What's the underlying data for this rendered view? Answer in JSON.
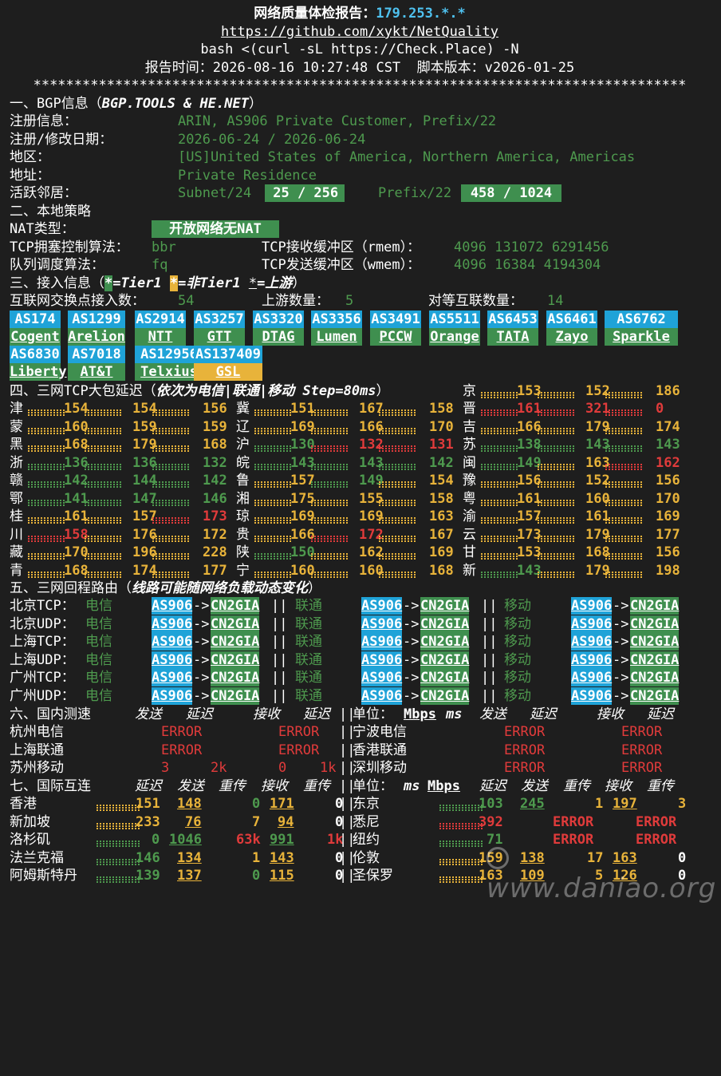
{
  "header": {
    "title_label": "网络质量体检报告：",
    "title_ip": "179.253.*.*",
    "url": "https://github.com/xykt/NetQuality",
    "command": "bash <(curl -sL https://Check.Place) -N",
    "time_line": "报告时间：2026-08-16 10:27:48 CST  脚本版本：v2026-01-25",
    "separator": "********************************************************************************"
  },
  "bgp": {
    "heading": "一、BGP信息（",
    "heading_source": "BGP.TOOLS & HE.NET",
    "heading_close": "）",
    "rows": [
      {
        "label": "注册信息：",
        "value": "ARIN, AS906 Private Customer, Prefix/22"
      },
      {
        "label": "注册/修改日期：",
        "value": "2026-06-24 / 2026-06-24"
      },
      {
        "label": "地区：",
        "value": "[US]United States of America, Northern America, Americas"
      },
      {
        "label": "地址：",
        "value": "Private Residence"
      }
    ],
    "neighbors_label": "活跃邻居：",
    "subnet_label": "Subnet/24",
    "subnet_value": " 25 / 256 ",
    "prefix_label": "Prefix/22",
    "prefix_value": " 458 / 1024 "
  },
  "local": {
    "heading": "二、本地策略",
    "nat_label": "NAT类型：",
    "nat_value": " 开放网络无NAT ",
    "tcp_cc_label": "TCP拥塞控制算法：",
    "tcp_cc_value": "bbr",
    "rmem_label": "TCP接收缓冲区（rmem）：",
    "rmem_value": "4096 131072 6291456",
    "qdisc_label": "队列调度算法：",
    "qdisc_value": "fq",
    "wmem_label": "TCP发送缓冲区（wmem）：",
    "wmem_value": "4096 16384 4194304"
  },
  "access": {
    "heading": "三、接入信息（",
    "legend1_mark": "*",
    "legend1_text": "=Tier1 ",
    "legend2_mark": "*",
    "legend2_text": "=非Tier1 ",
    "legend3_mark": "*",
    "legend3_text": "=上游",
    "heading_close": "）",
    "ix_label": "互联网交换点接入数：",
    "ix_value": "54",
    "upstream_label": "上游数量：",
    "upstream_value": "5",
    "peer_label": "对等互联数量：",
    "peer_value": "14",
    "as_list": [
      {
        "asn": "AS174",
        "name": "Cogent",
        "tier": "t1"
      },
      {
        "asn": "AS1299",
        "name": "Arelion",
        "tier": "t1"
      },
      {
        "asn": "AS2914",
        "name": "NTT",
        "tier": "t1"
      },
      {
        "asn": "AS3257",
        "name": "GTT",
        "tier": "t1"
      },
      {
        "asn": "AS3320",
        "name": "DTAG",
        "tier": "t1"
      },
      {
        "asn": "AS3356",
        "name": "Lumen",
        "tier": "t1"
      },
      {
        "asn": "AS3491",
        "name": "PCCW",
        "tier": "t1"
      },
      {
        "asn": "AS5511",
        "name": "Orange",
        "tier": "t1"
      },
      {
        "asn": "AS6453",
        "name": "TATA",
        "tier": "t1"
      },
      {
        "asn": "AS6461",
        "name": "Zayo",
        "tier": "t1"
      },
      {
        "asn": "AS6762",
        "name": "Sparkle",
        "tier": "t1"
      },
      {
        "asn": "AS6830",
        "name": "Liberty",
        "tier": "t1"
      },
      {
        "asn": "AS7018",
        "name": "AT&T",
        "tier": "t1"
      },
      {
        "asn": "AS12956",
        "name": "Telxius",
        "tier": "t1"
      },
      {
        "asn": "AS137409",
        "name": "GSL",
        "tier": "nt1"
      }
    ]
  },
  "latency": {
    "heading": "四、三网TCP大包延迟（",
    "heading_note": "依次为电信|联通|移动 Step=80ms",
    "heading_close": "）",
    "first": {
      "name": "京",
      "v": [
        "153",
        "152",
        "186"
      ],
      "c": [
        "y",
        "y",
        "y"
      ]
    },
    "rows": [
      [
        {
          "name": "津",
          "v": [
            "154",
            "154",
            "156"
          ],
          "c": [
            "y",
            "y",
            "y"
          ]
        },
        {
          "name": "冀",
          "v": [
            "151",
            "167",
            "158"
          ],
          "c": [
            "y",
            "y",
            "y"
          ]
        },
        {
          "name": "晋",
          "v": [
            "161",
            "321",
            "0"
          ],
          "c": [
            "r",
            "r",
            "r"
          ]
        }
      ],
      [
        {
          "name": "蒙",
          "v": [
            "160",
            "159",
            "159"
          ],
          "c": [
            "y",
            "y",
            "y"
          ]
        },
        {
          "name": "辽",
          "v": [
            "169",
            "166",
            "170"
          ],
          "c": [
            "y",
            "y",
            "y"
          ]
        },
        {
          "name": "吉",
          "v": [
            "166",
            "179",
            "174"
          ],
          "c": [
            "y",
            "y",
            "y"
          ]
        }
      ],
      [
        {
          "name": "黑",
          "v": [
            "168",
            "179",
            "168"
          ],
          "c": [
            "y",
            "y",
            "y"
          ]
        },
        {
          "name": "沪",
          "v": [
            "130",
            "132",
            "131"
          ],
          "c": [
            "gn",
            "r",
            "r"
          ]
        },
        {
          "name": "苏",
          "v": [
            "138",
            "143",
            "143"
          ],
          "c": [
            "gn",
            "gn",
            "gn"
          ]
        }
      ],
      [
        {
          "name": "浙",
          "v": [
            "136",
            "136",
            "132"
          ],
          "c": [
            "gn",
            "gn",
            "gn"
          ]
        },
        {
          "name": "皖",
          "v": [
            "143",
            "143",
            "142"
          ],
          "c": [
            "gn",
            "gn",
            "gn"
          ]
        },
        {
          "name": "闽",
          "v": [
            "149",
            "163",
            "162"
          ],
          "c": [
            "gn",
            "y",
            "r"
          ]
        }
      ],
      [
        {
          "name": "赣",
          "v": [
            "142",
            "144",
            "142"
          ],
          "c": [
            "gn",
            "gn",
            "gn"
          ]
        },
        {
          "name": "鲁",
          "v": [
            "157",
            "149",
            "154"
          ],
          "c": [
            "y",
            "gn",
            "y"
          ]
        },
        {
          "name": "豫",
          "v": [
            "156",
            "152",
            "156"
          ],
          "c": [
            "y",
            "y",
            "y"
          ]
        }
      ],
      [
        {
          "name": "鄂",
          "v": [
            "141",
            "147",
            "146"
          ],
          "c": [
            "gn",
            "gn",
            "gn"
          ]
        },
        {
          "name": "湘",
          "v": [
            "175",
            "155",
            "158"
          ],
          "c": [
            "y",
            "y",
            "y"
          ]
        },
        {
          "name": "粤",
          "v": [
            "161",
            "160",
            "170"
          ],
          "c": [
            "y",
            "y",
            "y"
          ]
        }
      ],
      [
        {
          "name": "桂",
          "v": [
            "161",
            "157",
            "173"
          ],
          "c": [
            "y",
            "y",
            "r"
          ]
        },
        {
          "name": "琼",
          "v": [
            "169",
            "169",
            "163"
          ],
          "c": [
            "y",
            "y",
            "y"
          ]
        },
        {
          "name": "渝",
          "v": [
            "157",
            "161",
            "169"
          ],
          "c": [
            "y",
            "y",
            "y"
          ]
        }
      ],
      [
        {
          "name": "川",
          "v": [
            "158",
            "176",
            "172"
          ],
          "c": [
            "r",
            "y",
            "y"
          ]
        },
        {
          "name": "贵",
          "v": [
            "166",
            "172",
            "167"
          ],
          "c": [
            "y",
            "r",
            "y"
          ]
        },
        {
          "name": "云",
          "v": [
            "173",
            "179",
            "177"
          ],
          "c": [
            "y",
            "y",
            "y"
          ]
        }
      ],
      [
        {
          "name": "藏",
          "v": [
            "170",
            "196",
            "228"
          ],
          "c": [
            "y",
            "y",
            "y"
          ]
        },
        {
          "name": "陕",
          "v": [
            "150",
            "162",
            "169"
          ],
          "c": [
            "gn",
            "y",
            "y"
          ]
        },
        {
          "name": "甘",
          "v": [
            "153",
            "168",
            "156"
          ],
          "c": [
            "y",
            "y",
            "y"
          ]
        }
      ],
      [
        {
          "name": "青",
          "v": [
            "168",
            "174",
            "177"
          ],
          "c": [
            "y",
            "y",
            "y"
          ]
        },
        {
          "name": "宁",
          "v": [
            "160",
            "160",
            "168"
          ],
          "c": [
            "y",
            "y",
            "y"
          ]
        },
        {
          "name": "新",
          "v": [
            "143",
            "179",
            "198"
          ],
          "c": [
            "gn",
            "y",
            "y"
          ]
        }
      ]
    ]
  },
  "route": {
    "heading": "五、三网回程路由（",
    "heading_note": "线路可能随网络负载动态变化",
    "heading_close": "）",
    "arrow": "->",
    "sep": "||",
    "rows": [
      {
        "label": "北京TCP：",
        "isp": [
          "电信",
          "联通",
          "移动"
        ],
        "as": "AS906",
        "path": "CN2GIA"
      },
      {
        "label": "北京UDP：",
        "isp": [
          "电信",
          "联通",
          "移动"
        ],
        "as": "AS906",
        "path": "CN2GIA"
      },
      {
        "label": "上海TCP：",
        "isp": [
          "电信",
          "联通",
          "移动"
        ],
        "as": "AS906",
        "path": "CN2GIA"
      },
      {
        "label": "上海UDP：",
        "isp": [
          "电信",
          "联通",
          "移动"
        ],
        "as": "AS906",
        "path": "CN2GIA"
      },
      {
        "label": "广州TCP：",
        "isp": [
          "电信",
          "联通",
          "移动"
        ],
        "as": "AS906",
        "path": "CN2GIA"
      },
      {
        "label": "广州UDP：",
        "isp": [
          "电信",
          "联通",
          "移动"
        ],
        "as": "AS906",
        "path": "CN2GIA"
      }
    ]
  },
  "domestic": {
    "heading": "六、国内测速",
    "cols": [
      "发送",
      "延迟",
      "接收",
      "延迟"
    ],
    "sep": "||",
    "unit_label": "单位：",
    "unit_mbps": "Mbps",
    "unit_ms": "ms",
    "rows": [
      [
        {
          "name": "杭州电信",
          "v": [
            "ERROR",
            "",
            "ERROR",
            ""
          ]
        },
        {
          "name": "宁波电信",
          "v": [
            "ERROR",
            "",
            "ERROR",
            ""
          ]
        }
      ],
      [
        {
          "name": "上海联通",
          "v": [
            "ERROR",
            "",
            "ERROR",
            ""
          ]
        },
        {
          "name": "香港联通",
          "v": [
            "ERROR",
            "",
            "ERROR",
            ""
          ]
        }
      ],
      [
        {
          "name": "苏州移动",
          "v": [
            "3",
            "2k",
            "0",
            "1k"
          ]
        },
        {
          "name": "深圳移动",
          "v": [
            "ERROR",
            "",
            "ERROR",
            ""
          ]
        }
      ]
    ]
  },
  "intl": {
    "heading": "七、国际互连",
    "cols": [
      "延迟",
      "发送",
      "重传",
      "接收",
      "重传"
    ],
    "sep": "||",
    "unit_label": "单位：",
    "unit_ms": "ms",
    "unit_mbps": "Mbps",
    "rows": [
      [
        {
          "name": "香港",
          "v": [
            "151",
            "148",
            "0",
            "171",
            "0"
          ],
          "c": [
            "y",
            "y",
            "gn",
            "y",
            "w"
          ]
        },
        {
          "name": "东京",
          "v": [
            "103",
            "245",
            "1",
            "197",
            "3"
          ],
          "c": [
            "gn",
            "gn",
            "y",
            "y",
            "y"
          ]
        }
      ],
      [
        {
          "name": "新加坡",
          "v": [
            "233",
            "76",
            "7",
            "94",
            "0"
          ],
          "c": [
            "y",
            "y",
            "y",
            "y",
            "w"
          ]
        },
        {
          "name": "悉尼",
          "v": [
            "392",
            "ERROR",
            "",
            "ERROR",
            ""
          ],
          "c": [
            "r",
            "r",
            "r",
            "r",
            "r"
          ]
        }
      ],
      [
        {
          "name": "洛杉矶",
          "v": [
            "0",
            "1046",
            "63k",
            "991",
            "1k"
          ],
          "c": [
            "gn",
            "gn",
            "r",
            "gn",
            "r"
          ]
        },
        {
          "name": "纽约",
          "v": [
            "71",
            "ERROR",
            "",
            "ERROR",
            ""
          ],
          "c": [
            "gn",
            "r",
            "r",
            "r",
            "r"
          ]
        }
      ],
      [
        {
          "name": "法兰克福",
          "v": [
            "146",
            "134",
            "1",
            "143",
            "0"
          ],
          "c": [
            "gn",
            "y",
            "y",
            "y",
            "w"
          ]
        },
        {
          "name": "伦敦",
          "v": [
            "159",
            "138",
            "17",
            "163",
            "0"
          ],
          "c": [
            "y",
            "y",
            "y",
            "y",
            "w"
          ]
        }
      ],
      [
        {
          "name": "阿姆斯特丹",
          "v": [
            "139",
            "137",
            "0",
            "115",
            "0"
          ],
          "c": [
            "gn",
            "y",
            "gn",
            "y",
            "w"
          ]
        },
        {
          "name": "圣保罗",
          "v": [
            "163",
            "109",
            "5",
            "126",
            "0"
          ],
          "c": [
            "y",
            "y",
            "y",
            "y",
            "w"
          ]
        }
      ]
    ]
  },
  "watermark": "www.daniao.org",
  "colors": {
    "green": "#4e9a4e",
    "yellow": "#e8b33a",
    "red": "#e03b3b",
    "cyan": "#4fc1ef",
    "bg": "#1e1e1e"
  }
}
